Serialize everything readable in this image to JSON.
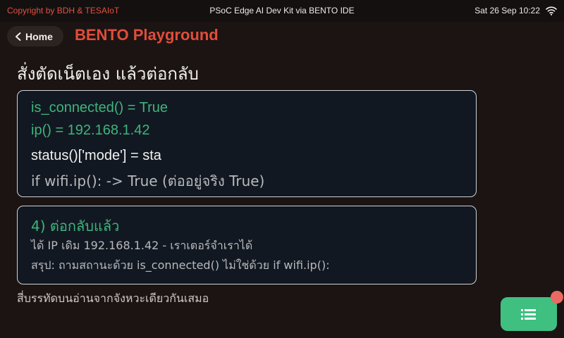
{
  "topbar": {
    "copyright": "Copyright by BDH & TESAIoT",
    "title": "PSoC Edge AI Dev Kit via BENTO IDE",
    "clock": "Sat 26 Sep 10:22",
    "wifi_icon": "wifi-icon"
  },
  "nav": {
    "home_label": "Home",
    "app_title": "BENTO Playground"
  },
  "page": {
    "heading": "สั่งตัดเน็ตเอง แล้วต่อกลับ"
  },
  "card1": {
    "line1": "is_connected() = True",
    "line2": "ip() = 192.168.1.42",
    "line3": "status()['mode'] = sta",
    "line4": "if wifi.ip(): -> True   (ต่ออยู่จริง True)"
  },
  "card2": {
    "title": "4) ต่อกลับแล้ว",
    "line1": "ได้ IP เดิม 192.168.1.42 - เราเตอร์จำเราได้",
    "line2": "สรุป: ถามสถานะด้วย is_connected() ไม่ใช่ด้วย if wifi.ip():"
  },
  "footer": {
    "note": "สี่บรรทัดบนอ่านจากจังหวะเดียวกันเสมอ"
  },
  "fab": {
    "icon": "list-icon",
    "color": "#3fbf80",
    "badge_color": "#e86a62"
  },
  "colors": {
    "accent": "#e24d3a",
    "success": "#3fb47c",
    "background": "#1b1413",
    "card": "#121821"
  }
}
